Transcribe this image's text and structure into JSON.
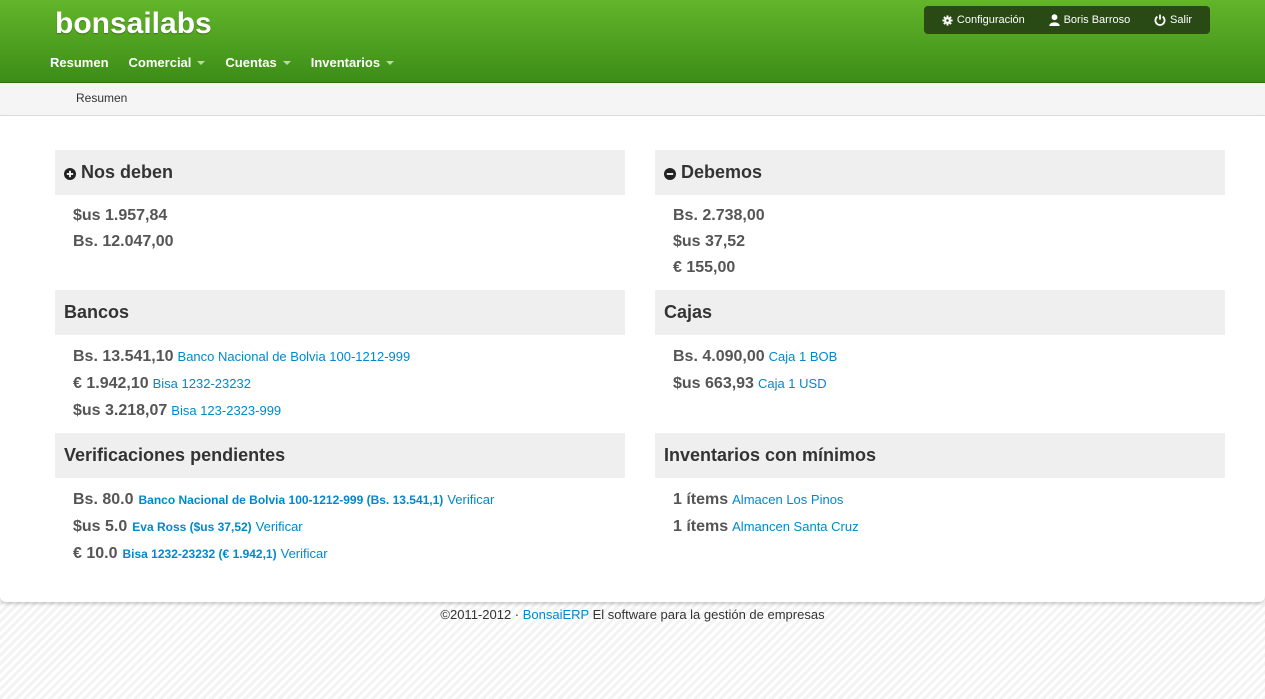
{
  "brand": "bonsailabs",
  "nav": {
    "resumen": "Resumen",
    "comercial": "Comercial",
    "cuentas": "Cuentas",
    "inventarios": "Inventarios"
  },
  "user_menu": {
    "config": "Configuración",
    "user": "Boris Barroso",
    "logout": "Salir"
  },
  "breadcrumb": "Resumen",
  "panels": {
    "nos_deben": {
      "title": "Nos deben",
      "rows": [
        "$us 1.957,84",
        "Bs. 12.047,00"
      ]
    },
    "debemos": {
      "title": "Debemos",
      "rows": [
        "Bs. 2.738,00",
        "$us 37,52",
        "€ 155,00"
      ]
    },
    "bancos": {
      "title": "Bancos",
      "rows": [
        {
          "amount": "Bs. 13.541,10",
          "link": "Banco Nacional de Bolvia 100-1212-999"
        },
        {
          "amount": "€ 1.942,10",
          "link": "Bisa 1232-23232"
        },
        {
          "amount": "$us 3.218,07",
          "link": "Bisa 123-2323-999"
        }
      ]
    },
    "cajas": {
      "title": "Cajas",
      "rows": [
        {
          "amount": "Bs. 4.090,00",
          "link": "Caja 1 BOB"
        },
        {
          "amount": "$us 663,93",
          "link": "Caja 1 USD"
        }
      ]
    },
    "verificaciones": {
      "title": "Verificaciones pendientes",
      "rows": [
        {
          "amount": "Bs. 80.0",
          "account": "Banco Nacional de Bolvia 100-1212-999 (Bs. 13.541,1)",
          "action": "Verificar"
        },
        {
          "amount": "$us 5.0",
          "account": "Eva Ross ($us 37,52)",
          "action": "Verificar"
        },
        {
          "amount": "€ 10.0",
          "account": "Bisa 1232-23232 (€ 1.942,1)",
          "action": "Verificar"
        }
      ]
    },
    "inventarios": {
      "title": "Inventarios con mínimos",
      "rows": [
        {
          "amount": "1 ítems",
          "link": "Almacen Los Pinos"
        },
        {
          "amount": "1 ítems",
          "link": "Almancen Santa Cruz"
        }
      ]
    }
  },
  "footer": {
    "prefix": "©2011-2012 ·",
    "link": "BonsaiERP",
    "suffix": "El software para la gestión de empresas"
  },
  "colors": {
    "header_top": "#63b52a",
    "header_bottom": "#3c8d17",
    "link": "#0088cc",
    "panel_head_bg": "#efefef"
  },
  "icons": {
    "plus": "plus-circle-icon",
    "minus": "minus-circle-icon",
    "gear": "gear-icon",
    "user": "user-icon",
    "power": "power-icon"
  }
}
